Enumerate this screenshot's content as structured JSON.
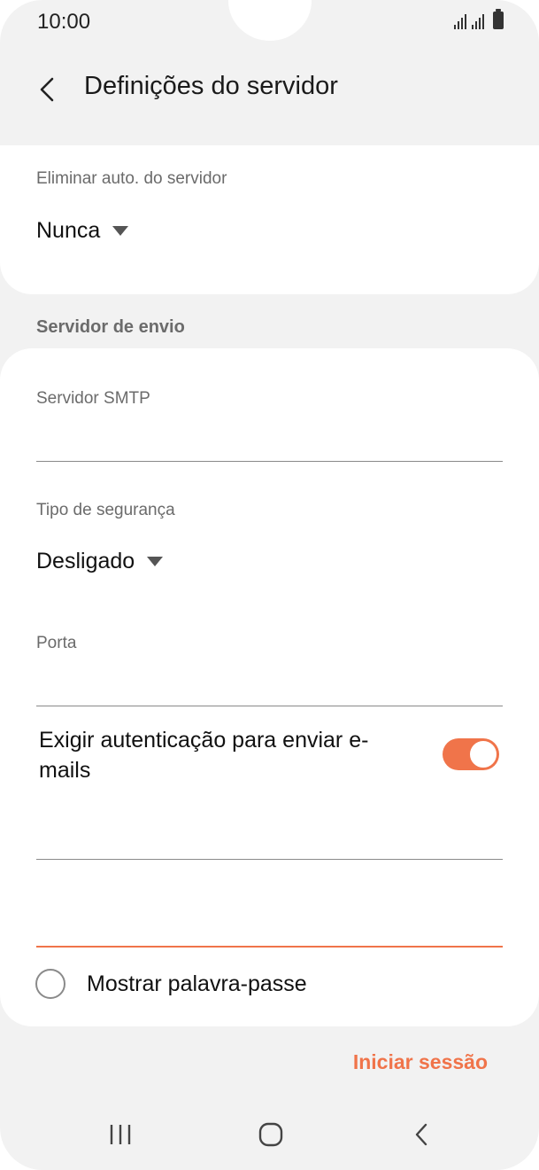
{
  "status_bar": {
    "time": "10:00"
  },
  "header": {
    "title": "Definições do servidor"
  },
  "incoming": {
    "delete_label": "Eliminar auto. do servidor",
    "delete_value": "Nunca"
  },
  "outgoing": {
    "section_title": "Servidor de envio",
    "smtp_label": "Servidor SMTP",
    "smtp_value": "",
    "security_label": "Tipo de segurança",
    "security_value": "Desligado",
    "port_label": "Porta",
    "port_value": "",
    "auth_label": "Exigir autenticação para enviar e-mails",
    "auth_enabled": true,
    "username_value": "",
    "password_value": "",
    "show_password_label": "Mostrar palavra-passe",
    "show_password_checked": false
  },
  "actions": {
    "login_label": "Iniciar sessão"
  },
  "colors": {
    "accent": "#f0744a",
    "background": "#f2f2f2",
    "card": "#ffffff"
  }
}
